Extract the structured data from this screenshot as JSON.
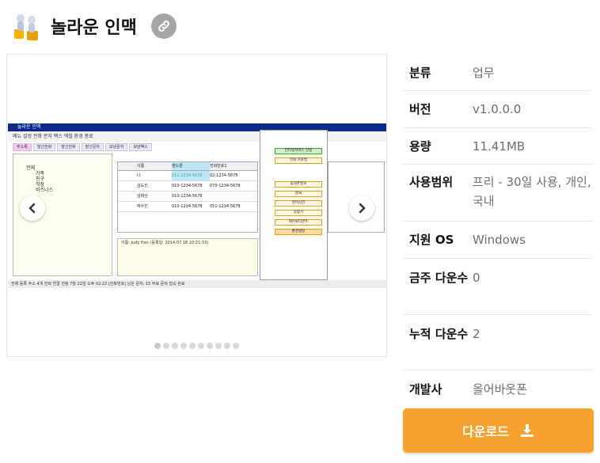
{
  "app": {
    "title": "놀라운 인맥"
  },
  "info": {
    "category": {
      "label": "분류",
      "value": "업무"
    },
    "version": {
      "label": "버전",
      "value": "v1.0.0.0"
    },
    "size": {
      "label": "용량",
      "value": "11.41MB"
    },
    "license": {
      "label": "사용범위",
      "value": "프리 - 30일 사용, 개인, 국내"
    },
    "os": {
      "label": "지원 OS",
      "value": "Windows"
    },
    "weekly": {
      "label": "금주 다운수",
      "value": "0"
    },
    "total": {
      "label": "누적 다운수",
      "value": "2"
    },
    "developer": {
      "label": "개발사",
      "value": "올어바웃폰"
    }
  },
  "download": {
    "label": "다운로드"
  },
  "gallery": {
    "dot_count": 10,
    "active_index": 0
  },
  "screenshot": {
    "window_title": "놀라운 인맥",
    "menu": "메뉴  설정  전화  문자  팩스  엑셀  환경  종료",
    "tabs": [
      "주소록",
      "발신전화",
      "발신전화",
      "발신문자",
      "보낸문자",
      "보낸팩스"
    ],
    "tree": [
      "전체",
      "가족",
      "친구",
      "직장",
      "비즈니스"
    ],
    "grid_headers": [
      "이름",
      "핸드폰",
      "전화번호1"
    ],
    "grid_rows": [
      [
        "나",
        "011-1234-5678",
        "02-1234-5678"
      ],
      [
        "김도진",
        "010-1234-5678",
        "070-1234-5678"
      ],
      [
        "김태산",
        "010-1234-5678",
        ""
      ],
      [
        "박수진",
        "010-1234-5678",
        "051-1234-5678"
      ]
    ],
    "memo": "이름: Judy Han (등록일: 2014.07.18 10:21:33)",
    "popup_items": [
      "인터넷서비스 신청",
      "전화 프로필",
      "휴대폰정보",
      "날씨",
      "영어사전",
      "길찾기",
      "테이쇼티콘트",
      "환경설정"
    ],
    "status": "전체 등록 주소 4개    전화 연결 안됨    7월 22일 오후 02:22  [전화번호] 남은 문자: 15  무료 문자 접속 완료"
  },
  "colors": {
    "accent": "#f7a12f",
    "link_button": "#a6a6a6",
    "window_title_bar": "#0b2a8a"
  }
}
